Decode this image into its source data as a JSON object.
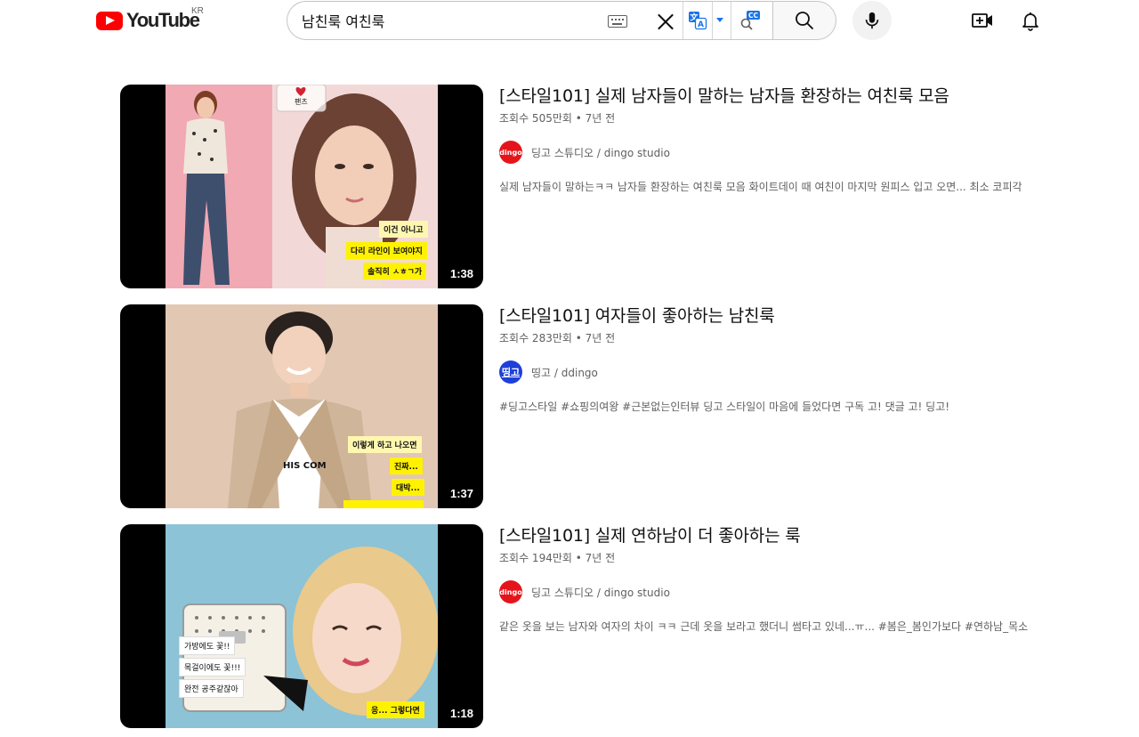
{
  "header": {
    "logo_text": "YouTube",
    "country": "KR",
    "search_value": "남친룩 여친룩",
    "icons": {
      "keyboard": "keyboard-icon",
      "clear": "close-icon",
      "translate": "translate-icon",
      "extension": "cc-search-icon",
      "search": "search-icon",
      "mic": "mic-icon",
      "create": "video-add-icon",
      "notifications": "bell-icon"
    }
  },
  "results": [
    {
      "title": "[스타일101] 실제 남자들이 말하는 남자들 환장하는 여친룩 모음",
      "views": "조회수 505만회",
      "age": "7년 전",
      "channel": "딩고 스튜디오 / dingo studio",
      "avatar_text": "dingo",
      "description": "실제 남자들이 말하는ㅋㅋ 남자들 환장하는 여친룩 모음 화이트데이 때 여친이 마지막 원피스 입고 오면... 최소 코피각",
      "duration": "1:38",
      "captions": [
        "팬츠",
        "이건 아니고",
        "다리 라인이 보여야지",
        "솔직히 ㅅㅎㄱ가"
      ]
    },
    {
      "title": "[스타일101] 여자들이 좋아하는 남친룩",
      "views": "조회수 283만회",
      "age": "7년 전",
      "channel": "띵고 / ddingo",
      "avatar_text": "띵고",
      "description": "#딩고스타일 #쇼핑의여왕 #근본없는인터뷰 딩고 스타일이 마음에 들었다면 구독 고! 댓글 고! 딩고!",
      "duration": "1:37",
      "captions": [
        "이렇게 하고 나오면",
        "진짜...",
        "대박...",
        "HIS COM"
      ]
    },
    {
      "title": "[스타일101] 실제 연하남이 더 좋아하는 룩",
      "views": "조회수 194만회",
      "age": "7년 전",
      "channel": "딩고 스튜디오 / dingo studio",
      "avatar_text": "dingo",
      "description": "같은 옷을 보는 남자와 여자의 차이 ㅋㅋ 근데 옷을 보라고 했더니 썸타고 있네...ㅠ... #봄은_봄인가보다 #연하남_목소",
      "duration": "1:18",
      "captions": [
        "가방에도 꽃!!",
        "목걸이에도 꽃!!!",
        "완전 공주같잖아",
        "응... 그렇다면"
      ]
    }
  ]
}
